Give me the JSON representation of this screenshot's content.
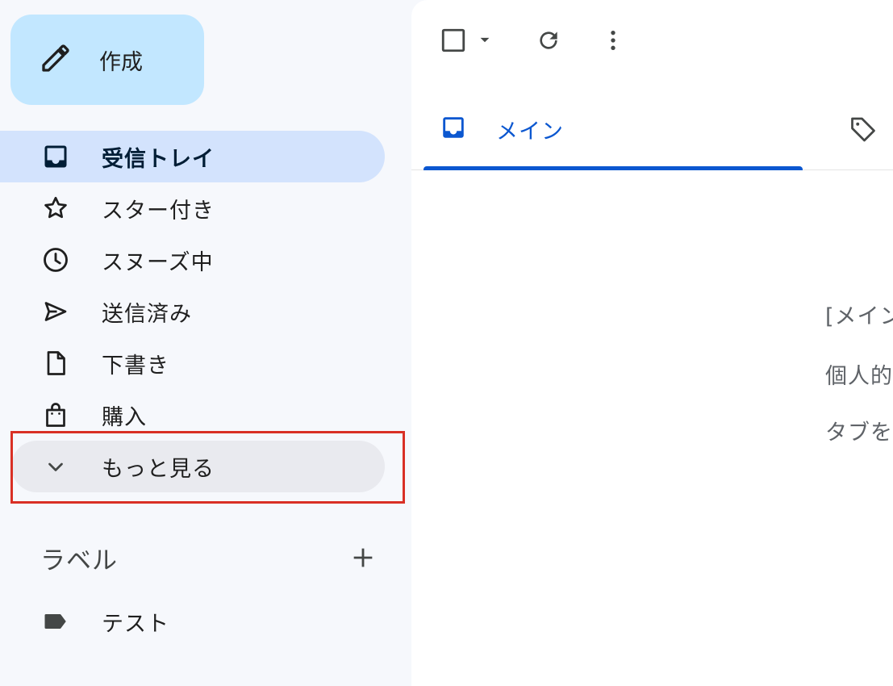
{
  "compose": {
    "label": "作成",
    "icon": "pencil-icon"
  },
  "nav": {
    "items": [
      {
        "label": "受信トレイ",
        "icon": "inbox-icon",
        "active": true
      },
      {
        "label": "スター付き",
        "icon": "star-icon"
      },
      {
        "label": "スヌーズ中",
        "icon": "clock-icon"
      },
      {
        "label": "送信済み",
        "icon": "send-icon"
      },
      {
        "label": "下書き",
        "icon": "draft-icon"
      },
      {
        "label": "購入",
        "icon": "shopping-bag-icon"
      }
    ],
    "more": {
      "label": "もっと見る",
      "icon": "chevron-down-icon"
    }
  },
  "labels": {
    "title": "ラベル",
    "items": [
      {
        "label": "テスト",
        "icon": "label-icon"
      }
    ]
  },
  "tabs": {
    "main": {
      "label": "メイン",
      "icon": "inbox-icon"
    },
    "promotions_icon": "tag-icon"
  },
  "empty_state": {
    "line1": "[メイン",
    "line2": "個人的",
    "line3": "タブを"
  },
  "colors": {
    "accent": "#0b57d0",
    "active_nav_bg": "#d3e3fd",
    "compose_bg": "#c2e7ff",
    "highlight": "#d93025"
  }
}
